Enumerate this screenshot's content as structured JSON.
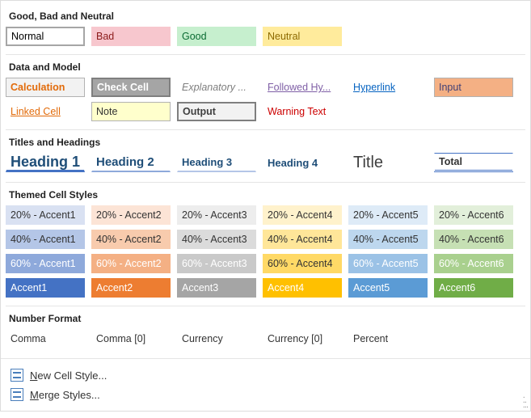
{
  "sections": {
    "gbn": {
      "title": "Good, Bad and Neutral",
      "items": [
        "Normal",
        "Bad",
        "Good",
        "Neutral"
      ]
    },
    "dm": {
      "title": "Data and Model",
      "items": [
        "Calculation",
        "Check Cell",
        "Explanatory ...",
        "Followed Hy...",
        "Hyperlink",
        "Input",
        "Linked Cell",
        "Note",
        "Output",
        "Warning Text"
      ]
    },
    "th": {
      "title": "Titles and Headings",
      "items": [
        "Heading 1",
        "Heading 2",
        "Heading 3",
        "Heading 4",
        "Title",
        "Total"
      ]
    },
    "themed": {
      "title": "Themed Cell Styles",
      "rows": [
        [
          "20% - Accent1",
          "20% - Accent2",
          "20% - Accent3",
          "20% - Accent4",
          "20% - Accent5",
          "20% - Accent6"
        ],
        [
          "40% - Accent1",
          "40% - Accent2",
          "40% - Accent3",
          "40% - Accent4",
          "40% - Accent5",
          "40% - Accent6"
        ],
        [
          "60% - Accent1",
          "60% - Accent2",
          "60% - Accent3",
          "60% - Accent4",
          "60% - Accent5",
          "60% - Accent6"
        ],
        [
          "Accent1",
          "Accent2",
          "Accent3",
          "Accent4",
          "Accent5",
          "Accent6"
        ]
      ]
    },
    "nf": {
      "title": "Number Format",
      "items": [
        "Comma",
        "Comma [0]",
        "Currency",
        "Currency [0]",
        "Percent"
      ]
    }
  },
  "footer": {
    "new_style": "New Cell Style...",
    "merge": "Merge Styles..."
  }
}
